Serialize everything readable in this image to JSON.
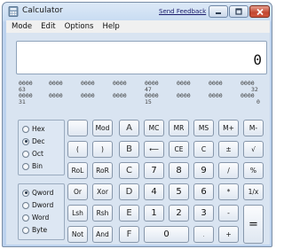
{
  "window": {
    "title": "Calculator",
    "send_feedback": "Send Feedback"
  },
  "menu": {
    "items": [
      "Mode",
      "Edit",
      "Options",
      "Help"
    ]
  },
  "display": {
    "value": "0"
  },
  "bits": {
    "row1": [
      "0000",
      "0000",
      "0000",
      "0000",
      "0000",
      "0000",
      "0000",
      "0000"
    ],
    "row1_labels": [
      "63",
      "47",
      "32"
    ],
    "row2": [
      "0000",
      "0000",
      "0000",
      "0000",
      "0000",
      "0000",
      "0000",
      "0000"
    ],
    "row2_labels": [
      "31",
      "15",
      "0"
    ]
  },
  "base_options": [
    "Hex",
    "Dec",
    "Oct",
    "Bin"
  ],
  "base_selected": "Dec",
  "word_options": [
    "Qword",
    "Dword",
    "Word",
    "Byte"
  ],
  "word_selected": "Qword",
  "keys": {
    "mod": "Mod",
    "A": "A",
    "MC": "MC",
    "MR": "MR",
    "MS": "MS",
    "Mplus": "M+",
    "Mminus": "M-",
    "lparen": "(",
    "rparen": ")",
    "B": "B",
    "backspace": "⟵",
    "CE": "CE",
    "C": "C",
    "plusminus": "±",
    "sqrt": "√",
    "RoL": "RoL",
    "RoR": "RoR",
    "Ckey": "C",
    "n7": "7",
    "n8": "8",
    "n9": "9",
    "div": "/",
    "pct": "%",
    "Or": "Or",
    "Xor": "Xor",
    "D": "D",
    "n4": "4",
    "n5": "5",
    "n6": "6",
    "mul": "*",
    "recip": "1/x",
    "Lsh": "Lsh",
    "Rsh": "Rsh",
    "E": "E",
    "n1": "1",
    "n2": "2",
    "n3": "3",
    "minus": "-",
    "equals": "=",
    "Not": "Not",
    "And": "And",
    "F": "F",
    "n0": "0",
    "dot": ".",
    "plus": "+"
  }
}
